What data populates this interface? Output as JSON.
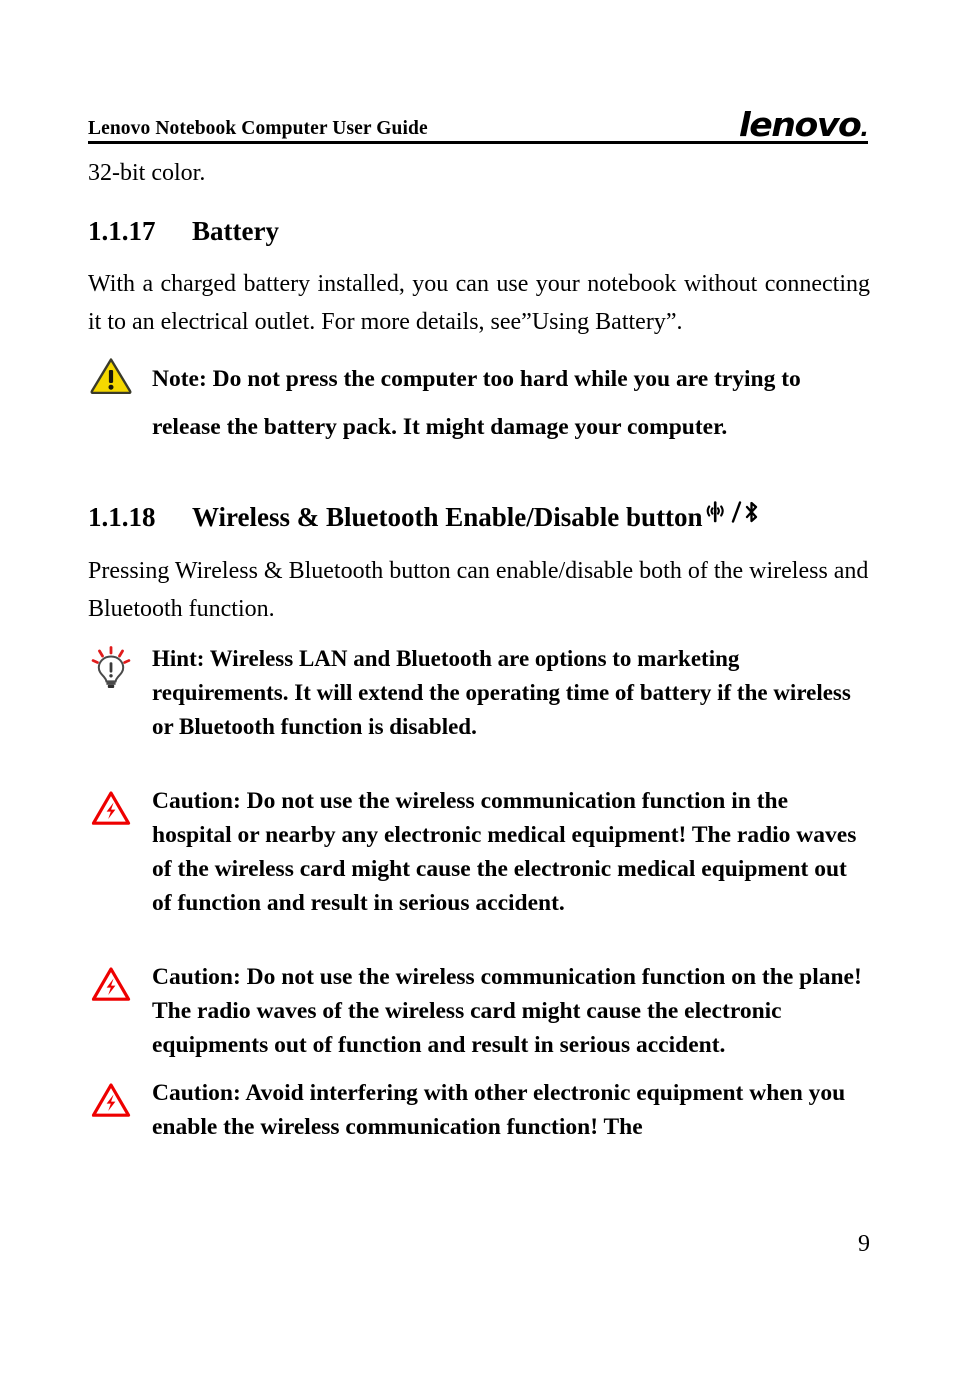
{
  "header": {
    "title": "Lenovo Notebook Computer User Guide",
    "logo_text": "lenovo",
    "logo_dot": "."
  },
  "body": {
    "orphan_line": "32-bit color.",
    "sections": [
      {
        "number": "1.1.17",
        "title": "Battery",
        "paragraph": "With a charged battery installed, you can use your notebook without connecting it to an electrical outlet. For more details, see”Using Battery”."
      },
      {
        "number": "1.1.18",
        "title": "Wireless & Bluetooth Enable/Disable button",
        "paragraph": "Pressing Wireless & Bluetooth button can enable/disable both of the wireless and Bluetooth function."
      }
    ],
    "callouts": [
      {
        "kind": "note",
        "icon": "warning-triangle-yellow-icon",
        "text": "Note: Do not press the computer too hard while you are trying to release the battery pack. It might damage your computer."
      },
      {
        "kind": "hint",
        "icon": "lightbulb-icon",
        "text": "Hint: Wireless LAN and Bluetooth are options to marketing requirements. It will extend the operating time of battery if the wireless or Bluetooth function is disabled."
      },
      {
        "kind": "caution",
        "icon": "caution-triangle-red-icon",
        "text": "Caution: Do not use the wireless communication function in the hospital or nearby any electronic medical equipment! The radio waves of the wireless card might cause the electronic medical equipment out of function and result in serious accident."
      },
      {
        "kind": "caution",
        "icon": "caution-triangle-red-icon",
        "text": "Caution: Do not use the wireless communication function on the plane! The radio waves of the wireless card might cause the electronic equipments out of function and result in serious accident."
      },
      {
        "kind": "caution",
        "icon": "caution-triangle-red-icon",
        "text": "Caution: Avoid interfering with other electronic equipment when you enable the wireless communication function! The"
      }
    ]
  },
  "footer": {
    "page_number": "9"
  },
  "colors": {
    "warning_yellow": "#f5d800",
    "caution_red": "#ee0000",
    "text_black": "#000000",
    "page_background": "#ffffff"
  }
}
